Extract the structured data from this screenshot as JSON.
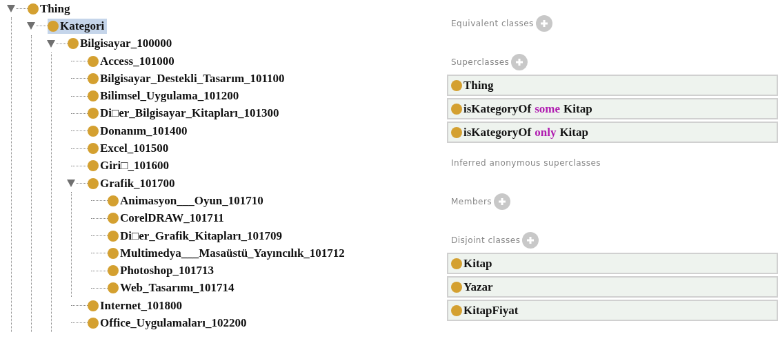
{
  "tree": [
    {
      "label": "Thing",
      "expanded": true,
      "selected": false,
      "children": [
        {
          "label": "Kategori",
          "expanded": true,
          "selected": true,
          "children": [
            {
              "label": "Bilgisayar_100000",
              "expanded": true,
              "selected": false,
              "children": [
                {
                  "label": "Access_101000",
                  "selected": false
                },
                {
                  "label": "Bilgisayar_Destekli_Tasarım_101100",
                  "selected": false
                },
                {
                  "label": "Bilimsel_Uygulama_101200",
                  "selected": false
                },
                {
                  "label": "Di□er_Bilgisayar_Kitapları_101300",
                  "selected": false
                },
                {
                  "label": "Donanım_101400",
                  "selected": false
                },
                {
                  "label": "Excel_101500",
                  "selected": false
                },
                {
                  "label": "Giri□_101600",
                  "selected": false
                },
                {
                  "label": "Grafik_101700",
                  "expanded": true,
                  "selected": false,
                  "children": [
                    {
                      "label": "Animasyon___Oyun_101710",
                      "selected": false
                    },
                    {
                      "label": "CorelDRAW_101711",
                      "selected": false
                    },
                    {
                      "label": "Di□er_Grafik_Kitapları_101709",
                      "selected": false
                    },
                    {
                      "label": "Multimedya___Masaüstü_Yayıncılık_101712",
                      "selected": false
                    },
                    {
                      "label": "Photoshop_101713",
                      "selected": false
                    },
                    {
                      "label": "Web_Tasarımı_101714",
                      "selected": false
                    }
                  ]
                },
                {
                  "label": "Internet_101800",
                  "selected": false
                },
                {
                  "label": "Office_Uygulamaları_102200",
                  "selected": false
                }
              ]
            }
          ]
        }
      ]
    }
  ],
  "sections": [
    {
      "title": "Equivalent classes",
      "add_button": true
    },
    {
      "title": "Superclasses",
      "add_button": true,
      "items": [
        {
          "parts": [
            {
              "kind": "name",
              "text": "Thing"
            }
          ]
        },
        {
          "parts": [
            {
              "kind": "name",
              "text": "isKategoryOf"
            },
            {
              "kind": "keyword",
              "text": "some"
            },
            {
              "kind": "name",
              "text": "Kitap"
            }
          ]
        },
        {
          "parts": [
            {
              "kind": "name",
              "text": "isKategoryOf"
            },
            {
              "kind": "keyword",
              "text": "only"
            },
            {
              "kind": "name",
              "text": "Kitap"
            }
          ]
        }
      ]
    },
    {
      "title": "Inferred anonymous superclasses",
      "add_button": false
    },
    {
      "title": "Members",
      "add_button": true
    },
    {
      "title": "Disjoint classes",
      "add_button": true,
      "items": [
        {
          "parts": [
            {
              "kind": "name",
              "text": "Kitap"
            }
          ]
        },
        {
          "parts": [
            {
              "kind": "name",
              "text": "Yazar"
            }
          ]
        },
        {
          "parts": [
            {
              "kind": "name",
              "text": "KitapFiyat"
            }
          ]
        }
      ]
    }
  ]
}
